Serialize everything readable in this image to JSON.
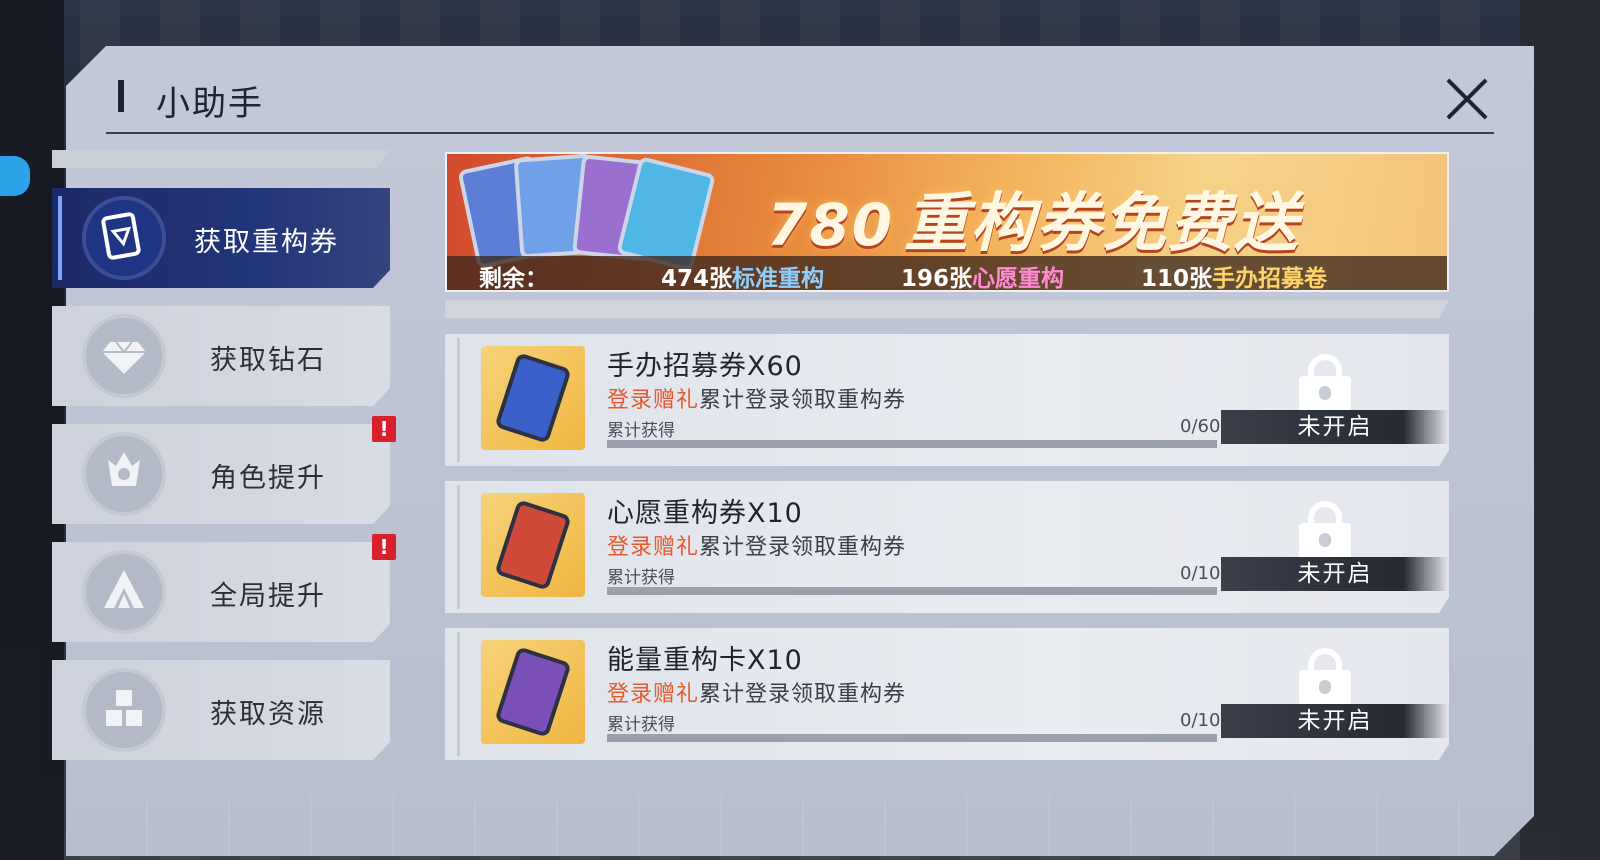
{
  "dialog": {
    "title": "小助手",
    "close_icon": "close-icon"
  },
  "sidebar": {
    "items": [
      {
        "label": "获取重构券",
        "icon": "ticket-card-icon",
        "active": true,
        "badge": ""
      },
      {
        "label": "获取钻石",
        "icon": "diamond-icon",
        "active": false,
        "badge": ""
      },
      {
        "label": "角色提升",
        "icon": "character-icon",
        "active": false,
        "badge": "!"
      },
      {
        "label": "全局提升",
        "icon": "mountain-icon",
        "active": false,
        "badge": "!"
      },
      {
        "label": "获取资源",
        "icon": "cubes-icon",
        "active": false,
        "badge": ""
      }
    ]
  },
  "banner": {
    "number": "780",
    "title": "重构券免费送",
    "remaining_label": "剩余：",
    "standard": {
      "count": "474张",
      "name": "标准重构"
    },
    "wish": {
      "count": "196张",
      "name": "心愿重构"
    },
    "figure": {
      "count": "110张",
      "name": "手办招募卷"
    }
  },
  "tasks": [
    {
      "title": "手办招募券X60",
      "tag": "登录赠礼",
      "desc": "累计登录领取重构券",
      "acc_label": "累计获得",
      "count": "0/60",
      "progress": 0,
      "status": "未开启",
      "thumb_color": "#3a5fc8"
    },
    {
      "title": "心愿重构券X10",
      "tag": "登录赠礼",
      "desc": "累计登录领取重构券",
      "acc_label": "累计获得",
      "count": "0/10",
      "progress": 0,
      "status": "未开启",
      "thumb_color": "#d04a3a"
    },
    {
      "title": "能量重构卡X10",
      "tag": "登录赠礼",
      "desc": "累计登录领取重构券",
      "acc_label": "累计获得",
      "count": "0/10",
      "progress": 0,
      "status": "未开启",
      "thumb_color": "#7a4fb8"
    }
  ],
  "colors": {
    "accent_active": "#1c2a66",
    "tag_orange": "#e65a2e",
    "badge_red": "#d8212c"
  }
}
